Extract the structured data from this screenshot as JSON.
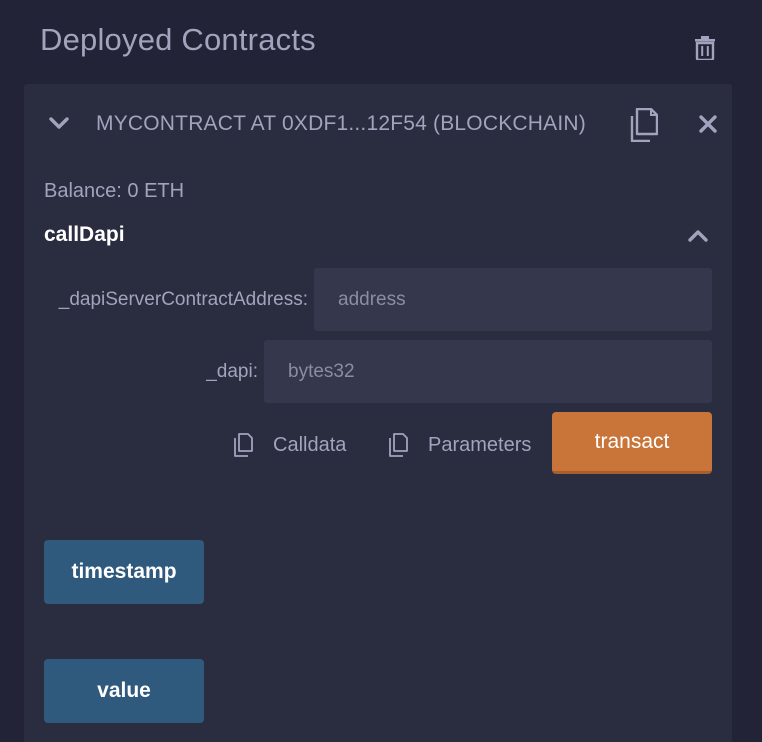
{
  "header": {
    "title": "Deployed Contracts",
    "trash_icon": "trash-icon"
  },
  "contract": {
    "title": "MYCONTRACT AT 0XDF1...12F54 (BLOCKCHAIN)",
    "balance": "Balance: 0 ETH",
    "function": {
      "name": "callDapi",
      "params": [
        {
          "label": "_dapiServerContractAddress:",
          "placeholder": "address",
          "value": ""
        },
        {
          "label": "_dapi:",
          "placeholder": "bytes32",
          "value": ""
        }
      ],
      "calldata_label": "Calldata",
      "parameters_label": "Parameters",
      "transact_label": "transact"
    },
    "buttons": {
      "timestamp": "timestamp",
      "value": "value"
    }
  },
  "colors": {
    "background": "#222336",
    "panel": "#2a2c3f",
    "input": "#35374c",
    "transact": "#c97539",
    "call_button": "#2f5a7d",
    "text": "#a2a3bd"
  }
}
